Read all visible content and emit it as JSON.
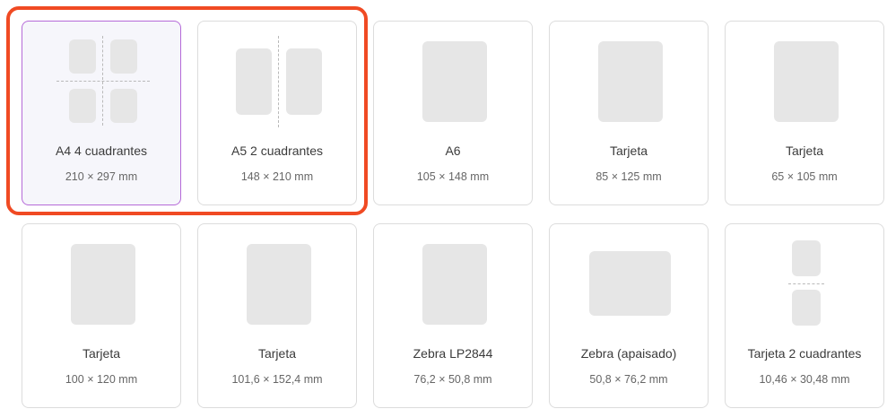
{
  "highlight_color": "#f04a23",
  "selected_border_color": "#b56ad8",
  "templates": [
    {
      "label": "A4 4 cuadrantes",
      "dims": "210 × 297 mm",
      "selected": true
    },
    {
      "label": "A5 2 cuadrantes",
      "dims": "148 × 210 mm",
      "selected": false
    },
    {
      "label": "A6",
      "dims": "105 × 148 mm",
      "selected": false
    },
    {
      "label": "Tarjeta",
      "dims": "85 × 125 mm",
      "selected": false
    },
    {
      "label": "Tarjeta",
      "dims": "65 × 105 mm",
      "selected": false
    },
    {
      "label": "Tarjeta",
      "dims": "100 × 120 mm",
      "selected": false
    },
    {
      "label": "Tarjeta",
      "dims": "101,6 × 152,4 mm",
      "selected": false
    },
    {
      "label": "Zebra LP2844",
      "dims": "76,2 × 50,8 mm",
      "selected": false
    },
    {
      "label": "Zebra (apaisado)",
      "dims": "50,8 × 76,2 mm",
      "selected": false
    },
    {
      "label": "Tarjeta 2 cuadrantes",
      "dims": "10,46 × 30,48 mm",
      "selected": false
    }
  ]
}
